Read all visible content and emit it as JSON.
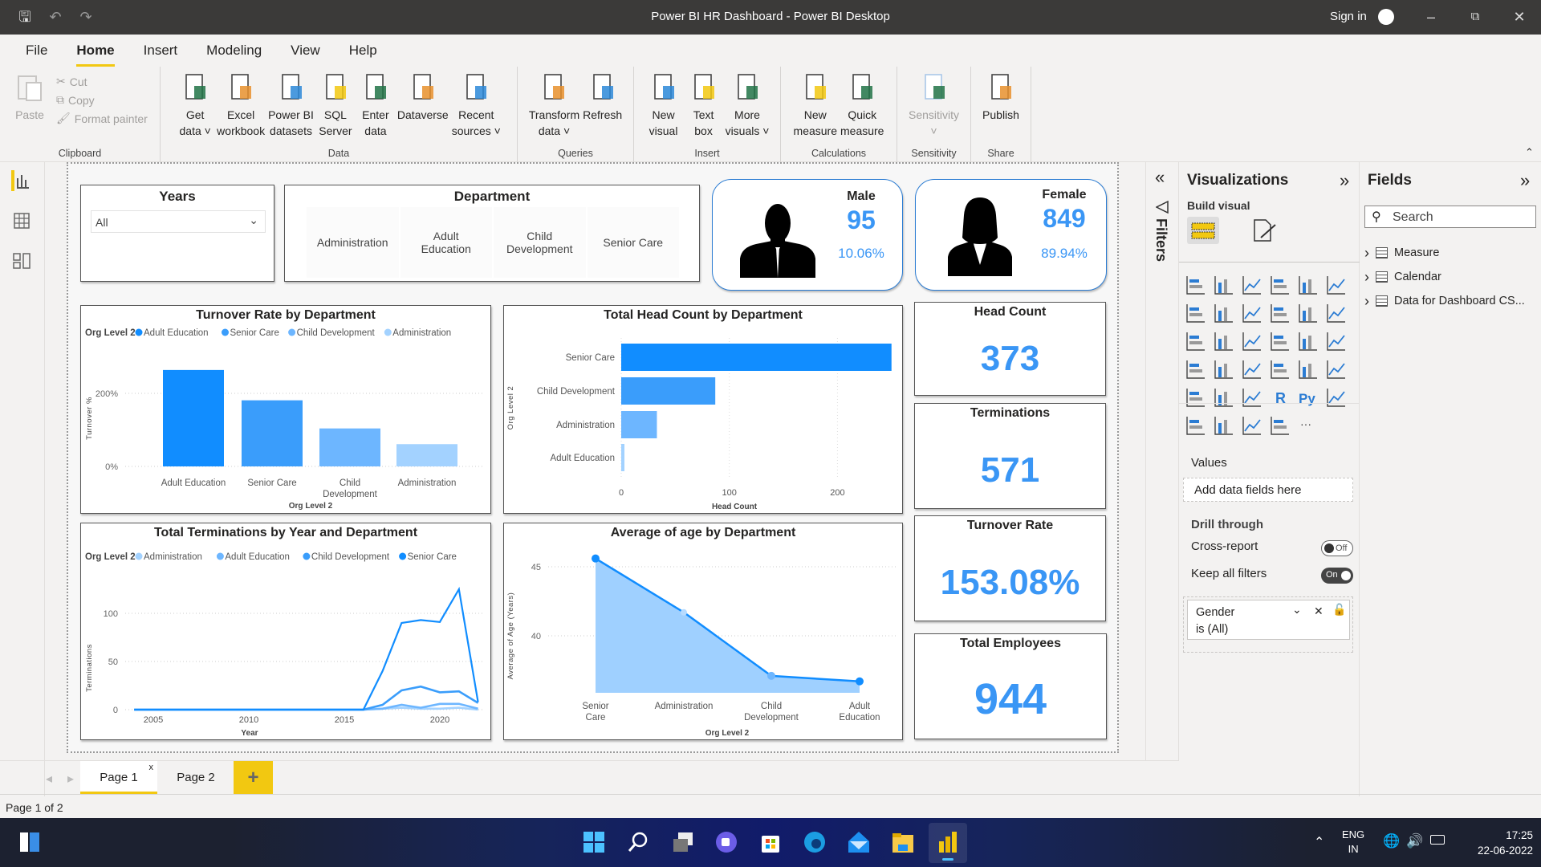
{
  "title_bar": {
    "title": "Power BI HR Dashboard - Power BI Desktop",
    "sign_in": "Sign in"
  },
  "menu": {
    "tabs": [
      "File",
      "Home",
      "Insert",
      "Modeling",
      "View",
      "Help"
    ],
    "active": "Home"
  },
  "ribbon": {
    "clipboard": {
      "label": "Clipboard",
      "paste": "Paste",
      "cut": "Cut",
      "copy": "Copy",
      "format_painter": "Format painter"
    },
    "groups": [
      {
        "label": "Data",
        "width": 445,
        "items": [
          [
            "Get",
            "data ˅"
          ],
          [
            "Excel",
            "workbook"
          ],
          [
            "Power BI",
            "datasets"
          ],
          [
            "SQL",
            "Server"
          ],
          [
            "Enter",
            "data"
          ],
          [
            "Dataverse",
            ""
          ],
          [
            "Recent",
            "sources ˅"
          ]
        ],
        "icons": [
          "database-icon",
          "excel-icon",
          "powerbi-datasets-icon",
          "sql-server-icon",
          "enter-data-icon",
          "dataverse-icon",
          "recent-sources-icon"
        ]
      },
      {
        "label": "Queries",
        "width": 145,
        "items": [
          [
            "Transform",
            "data ˅"
          ],
          [
            "Refresh",
            ""
          ]
        ],
        "icons": [
          "transform-data-icon",
          "refresh-icon"
        ]
      },
      {
        "label": "Insert",
        "width": 183,
        "items": [
          [
            "New",
            "visual"
          ],
          [
            "Text",
            "box"
          ],
          [
            "More",
            "visuals ˅"
          ]
        ],
        "icons": [
          "new-visual-icon",
          "text-box-icon",
          "more-visuals-icon"
        ]
      },
      {
        "label": "Calculations",
        "width": 145,
        "items": [
          [
            "New",
            "measure"
          ],
          [
            "Quick",
            "measure"
          ]
        ],
        "icons": [
          "new-measure-icon",
          "quick-measure-icon"
        ]
      },
      {
        "label": "Sensitivity",
        "width": 92,
        "items": [
          [
            "Sensitivity",
            "˅"
          ]
        ],
        "icons": [
          "sensitivity-icon"
        ],
        "disabled": true
      },
      {
        "label": "Share",
        "width": 75,
        "items": [
          [
            "Publish",
            ""
          ]
        ],
        "icons": [
          "publish-icon"
        ]
      }
    ]
  },
  "years_slicer": {
    "title": "Years",
    "value": "All"
  },
  "department_slicer": {
    "title": "Department",
    "items": [
      "Administration",
      "Adult Education",
      "Child Development",
      "Senior Care"
    ]
  },
  "male_card": {
    "label": "Male",
    "count": "95",
    "percent": "10.06%"
  },
  "female_card": {
    "label": "Female",
    "count": "849",
    "percent": "89.94%"
  },
  "kpis": [
    {
      "label": "Head Count",
      "value": "373"
    },
    {
      "label": "Terminations",
      "value": "571"
    },
    {
      "label": "Turnover Rate",
      "value": "153.08%"
    },
    {
      "label": "Total Employees",
      "value": "944"
    }
  ],
  "colors": {
    "accent": "#118DFF",
    "series": [
      "#118DFF",
      "#3A9DFB",
      "#6DB6FF",
      "#A3D2FF"
    ],
    "kpi": "#3A96F5",
    "highlight": "#F2C811"
  },
  "chart_data": [
    {
      "type": "bar",
      "title": "Turnover Rate by Department",
      "legend_title": "Org Level 2",
      "legend": [
        "Adult Education",
        "Senior Care",
        "Child Development",
        "Administration"
      ],
      "categories": [
        "Adult Education",
        "Senior Care",
        "Child Development",
        "Administration"
      ],
      "values": [
        264,
        181,
        104,
        61
      ],
      "unit": "%",
      "xlabel": "Org Level 2",
      "ylabel": "Turnover %",
      "yticks": [
        "0%",
        "200%"
      ],
      "ylim": [
        0,
        280
      ],
      "grid": true
    },
    {
      "type": "bar",
      "orientation": "horizontal",
      "title": "Total Head Count by Department",
      "categories": [
        "Senior Care",
        "Child Development",
        "Administration",
        "Adult Education"
      ],
      "values": [
        250,
        87,
        33,
        3
      ],
      "xlabel": "Head Count",
      "ylabel": "Org Level 2",
      "xticks": [
        "0",
        "100",
        "200"
      ],
      "xlim": [
        0,
        250
      ],
      "grid": true
    },
    {
      "type": "line",
      "title": "Total Terminations by Year and Department",
      "legend_title": "Org Level 2",
      "x": [
        2004,
        2005,
        2006,
        2007,
        2008,
        2009,
        2010,
        2011,
        2012,
        2013,
        2014,
        2015,
        2016,
        2017,
        2018,
        2019,
        2020,
        2021,
        2022
      ],
      "series": [
        {
          "name": "Administration",
          "values": [
            0,
            0,
            0,
            0,
            0,
            0,
            0,
            0,
            0,
            0,
            0,
            0,
            0,
            1,
            2,
            1,
            1,
            2,
            0
          ]
        },
        {
          "name": "Adult Education",
          "values": [
            0,
            0,
            0,
            0,
            0,
            0,
            0,
            0,
            0,
            0,
            0,
            0,
            0,
            1,
            5,
            2,
            6,
            6,
            1
          ]
        },
        {
          "name": "Child Development",
          "values": [
            0,
            0,
            0,
            0,
            0,
            0,
            0,
            0,
            0,
            0,
            0,
            0,
            0,
            5,
            20,
            24,
            18,
            19,
            7
          ]
        },
        {
          "name": "Senior Care",
          "values": [
            0,
            0,
            0,
            0,
            0,
            0,
            0,
            0,
            0,
            0,
            0,
            0,
            0,
            40,
            90,
            93,
            91,
            125,
            8
          ]
        }
      ],
      "xlabel": "Year",
      "ylabel": "Terminations",
      "xticks": [
        "2005",
        "2010",
        "2015",
        "2020"
      ],
      "yticks": [
        "0",
        "50",
        "100"
      ],
      "ylim": [
        0,
        130
      ],
      "grid": true
    },
    {
      "type": "area",
      "title": "Average of age by Department",
      "categories": [
        "Senior Care",
        "Administration",
        "Child Development",
        "Adult Education"
      ],
      "values": [
        45.6,
        41.7,
        37.1,
        36.7
      ],
      "xlabel": "Org Level 2",
      "ylabel": "Average of Age (Years)",
      "yticks": [
        "40",
        "45"
      ],
      "ylim": [
        35.9,
        47
      ],
      "grid": true
    }
  ],
  "filters_label": "Filters",
  "viz_pane": {
    "title": "Visualizations",
    "build_visual": "Build visual",
    "values_label": "Values",
    "add_fields": "Add data fields here",
    "drill_through": "Drill through",
    "cross_report": "Cross-report",
    "cross_report_state": "Off",
    "keep_all_filters": "Keep all filters",
    "keep_all_filters_state": "On",
    "filter_card": {
      "field": "Gender",
      "condition": "is (All)"
    },
    "visual_icons": [
      "stacked-bar-icon",
      "stacked-column-icon",
      "clustered-bar-icon",
      "clustered-column-icon",
      "100-stacked-bar-icon",
      "100-stacked-column-icon",
      "line-chart-icon",
      "area-chart-icon",
      "stacked-area-icon",
      "line-column-icon",
      "line-clustered-column-icon",
      "ribbon-chart-icon",
      "waterfall-icon",
      "funnel-icon",
      "scatter-icon",
      "pie-icon",
      "donut-icon",
      "treemap-icon",
      "map-icon",
      "filled-map-icon",
      "gauge-icon",
      "card-icon",
      "multi-row-card-icon",
      "kpi-icon",
      "slicer-icon",
      "table-icon",
      "matrix-icon",
      "r-visual-icon",
      "python-visual-icon",
      "key-influencers-icon",
      "decomposition-tree-icon",
      "qa-icon",
      "smart-narrative-icon",
      "paginated-report-icon",
      "more-icon"
    ]
  },
  "fields_pane": {
    "title": "Fields",
    "search_placeholder": "Search",
    "tables": [
      "Measure",
      "Calendar",
      "Data for Dashboard CS..."
    ]
  },
  "pages": {
    "tabs": [
      "Page 1",
      "Page 2"
    ],
    "active": "Page 1",
    "add": "+",
    "status": "Page 1 of 2"
  },
  "taskbar": {
    "lang1": "ENG",
    "lang2": "IN",
    "time": "17:25",
    "date": "22-06-2022"
  }
}
